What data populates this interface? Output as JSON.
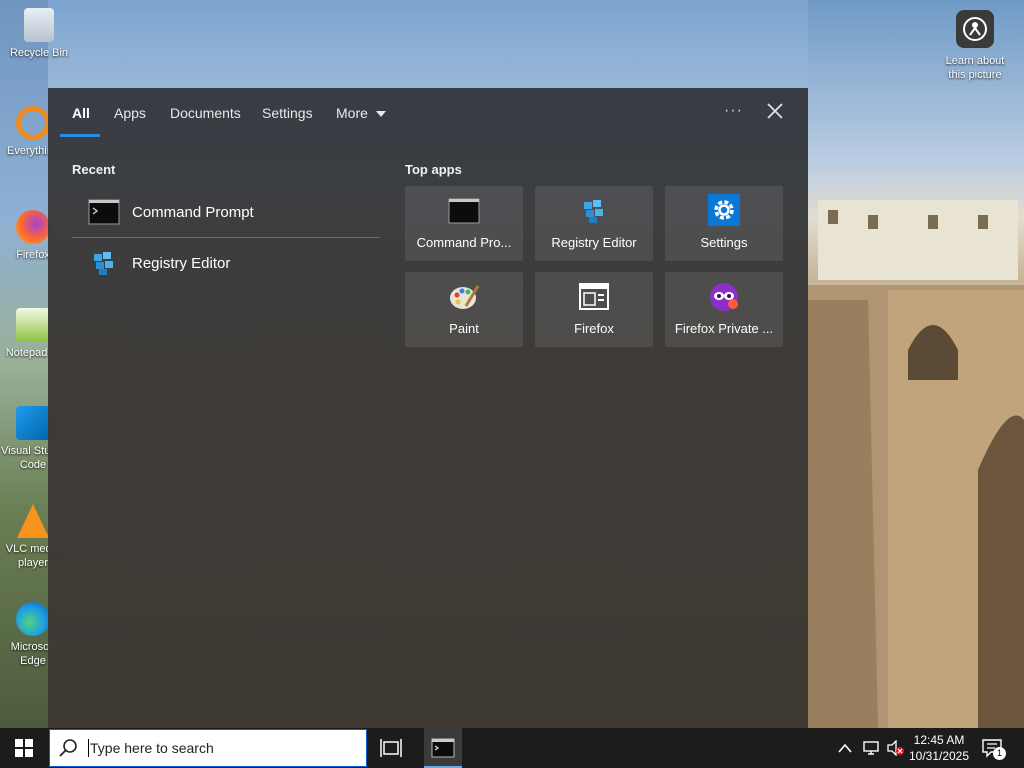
{
  "desktop": {
    "icons": [
      {
        "label": "Recycle Bin"
      },
      {
        "label": "Everything"
      },
      {
        "label": "Firefox"
      },
      {
        "label": "Notepad++"
      },
      {
        "label": "Visual Studio Code"
      },
      {
        "label": "VLC media player"
      },
      {
        "label": "Microsoft Edge"
      }
    ],
    "learn_label": "Learn about this picture"
  },
  "search_panel": {
    "tabs": [
      {
        "label": "All"
      },
      {
        "label": "Apps"
      },
      {
        "label": "Documents"
      },
      {
        "label": "Settings"
      },
      {
        "label": "More"
      }
    ],
    "recent_title": "Recent",
    "recent": [
      {
        "label": "Command Prompt",
        "icon": "cmd-icon"
      },
      {
        "label": "Registry Editor",
        "icon": "registry-icon"
      }
    ],
    "top_apps_title": "Top apps",
    "top_apps": [
      {
        "label": "Command Pro...",
        "icon": "cmd-icon"
      },
      {
        "label": "Registry Editor",
        "icon": "registry-icon"
      },
      {
        "label": "Settings",
        "icon": "gear-icon"
      },
      {
        "label": "Paint",
        "icon": "paint-icon"
      },
      {
        "label": "Firefox",
        "icon": "firefox-icon"
      },
      {
        "label": "Firefox Private ...",
        "icon": "firefox-private-icon"
      }
    ]
  },
  "taskbar": {
    "search_placeholder": "Type here to search",
    "time": "12:45 AM",
    "date": "10/31/2025",
    "notification_count": "1"
  },
  "colors": {
    "accent": "#2b8be0",
    "taskbar": "#1c1c1c"
  }
}
